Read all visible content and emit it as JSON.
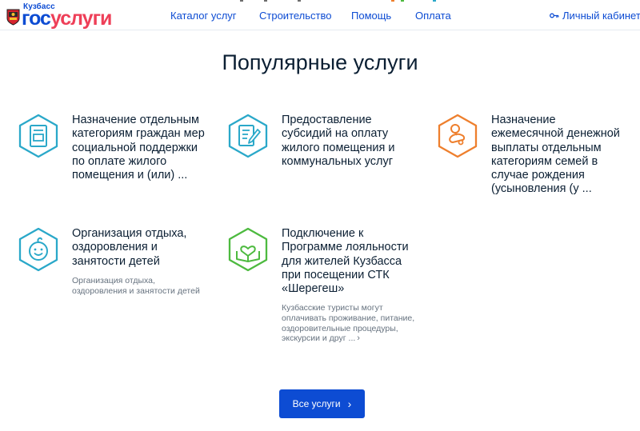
{
  "header": {
    "region": "Кузбасс",
    "logo_part1": "гос",
    "logo_part2": "услуги",
    "nav": [
      "Каталог услуг",
      "Строительство",
      "Помощь",
      "Оплата"
    ],
    "cabinet_label": "Личный кабинет",
    "cabinet_icon": "key-icon"
  },
  "main": {
    "title": "Популярные услуги",
    "services": [
      {
        "title": "Назначение отдельным категориям граждан мер социальной поддержки по оплате жилого помещения и (или) ...",
        "description": "",
        "icon": "document-icon",
        "icon_color": "#2aa8c9"
      },
      {
        "title": "Предоставление субсидий на оплату жилого помещения и коммунальных услуг",
        "description": "",
        "icon": "edit-document-icon",
        "icon_color": "#2aa8c9"
      },
      {
        "title": "Назначение ежемесячной денежной выплаты отдельным категориям семей в случае рождения (усыновления (у ...",
        "description": "",
        "icon": "pacifier-icon",
        "icon_color": "#ee7f2d"
      },
      {
        "title": "Организация отдыха, оздоровления и занятости детей",
        "description": "Организация отдыха, оздоровления и занятости детей",
        "icon": "child-face-icon",
        "icon_color": "#2aa8c9"
      },
      {
        "title": "Подключение к Программе лояльности для жителей Кузбасса при посещении СТК «Шерегеш»",
        "description": "Кузбасские туристы могут оплачивать проживание, питание, оздоровительные процедуры, экскурсии и друг ...",
        "icon": "heart-book-icon",
        "icon_color": "#4dba3f"
      }
    ],
    "all_button": "Все услуги"
  },
  "colors": {
    "brand_blue": "#0d4cd3",
    "brand_red": "#ee3f58",
    "text": "#0b1f33",
    "muted": "#66727f"
  }
}
